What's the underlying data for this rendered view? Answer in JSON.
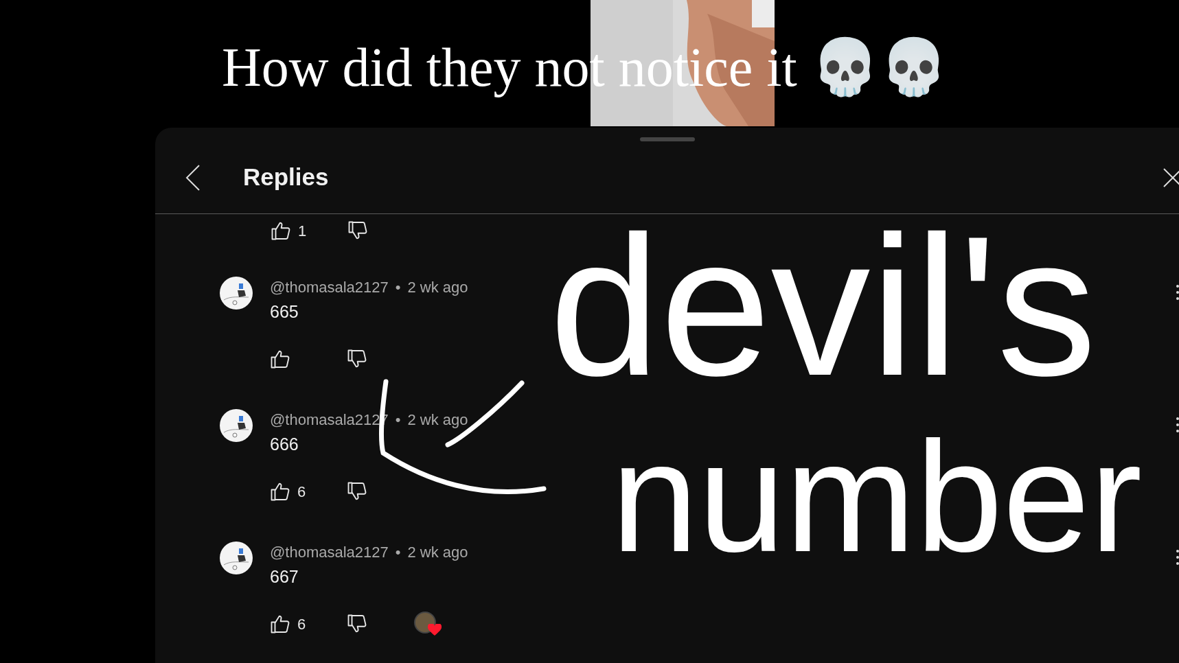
{
  "caption": "How did they not notice it 💀💀",
  "header": {
    "title": "Replies"
  },
  "top_actions": {
    "likes": "1"
  },
  "comments": [
    {
      "author": "@thomasala2127",
      "separator": "•",
      "time": "2 wk ago",
      "text": "665",
      "creator_heart": false
    },
    {
      "author": "@thomasala2127",
      "separator": "•",
      "time": "2 wk ago",
      "text": "666",
      "likes": "6",
      "creator_heart": false
    },
    {
      "author": "@thomasala2127",
      "separator": "•",
      "time": "2 wk ago",
      "text": "667",
      "likes": "6",
      "creator_heart": true
    }
  ],
  "annotation": {
    "lines": [
      "devil's",
      "number"
    ]
  }
}
